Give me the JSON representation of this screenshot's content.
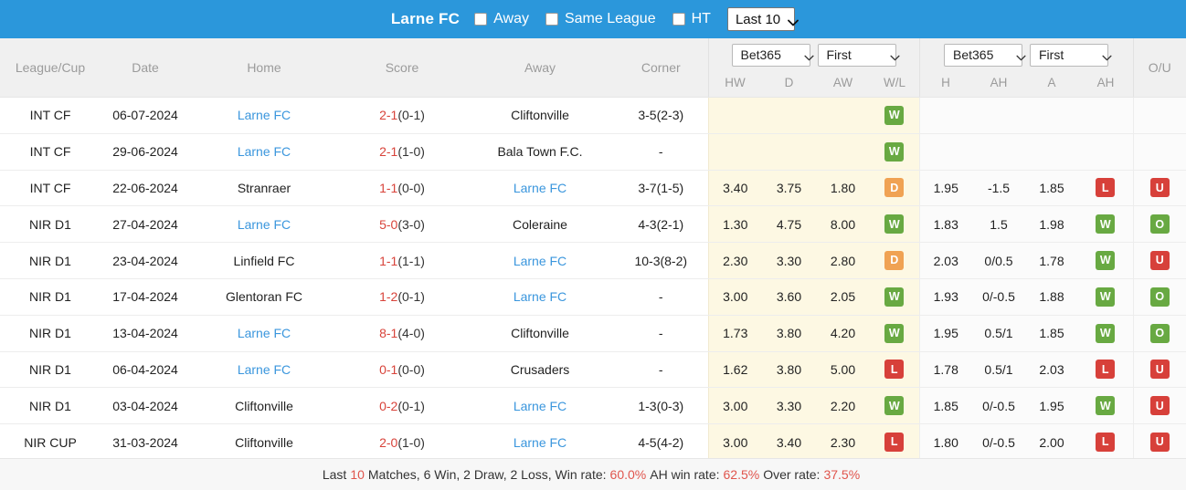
{
  "topbar": {
    "team_name": "Larne FC",
    "filters": [
      {
        "label": "Away",
        "checked": false
      },
      {
        "label": "Same League",
        "checked": false
      },
      {
        "label": "HT",
        "checked": false
      }
    ],
    "range_select": {
      "value": "Last 10",
      "icon": "chevron-down-icon"
    },
    "background_color": "#2b97db"
  },
  "table": {
    "columns": [
      {
        "key": "league",
        "label": "League/Cup"
      },
      {
        "key": "date",
        "label": "Date"
      },
      {
        "key": "home",
        "label": "Home"
      },
      {
        "key": "score",
        "label": "Score"
      },
      {
        "key": "away",
        "label": "Away"
      },
      {
        "key": "corner",
        "label": "Corner"
      }
    ],
    "odds_group_1x2": {
      "bookmaker_select": {
        "value": "Bet365",
        "icon": "chevron-down-icon"
      },
      "phase_select": {
        "value": "First",
        "icon": "chevron-down-icon"
      },
      "sub_columns": [
        "HW",
        "D",
        "AW",
        "W/L"
      ]
    },
    "odds_group_ah": {
      "bookmaker_select": {
        "value": "Bet365",
        "icon": "chevron-down-icon"
      },
      "phase_select": {
        "value": "First",
        "icon": "chevron-down-icon"
      },
      "sub_columns": [
        "H",
        "AH",
        "A",
        "AH"
      ]
    },
    "ou_column": {
      "label": "O/U"
    },
    "rows": [
      {
        "league": "INT CF",
        "date": "06-07-2024",
        "home": "Larne FC",
        "home_is_team": true,
        "score": "2-1",
        "score_ht": "(0-1)",
        "away": "Cliftonville",
        "away_is_team": false,
        "corner": "3-5(2-3)",
        "hw": "",
        "d": "",
        "aw": "",
        "wl": "W",
        "h": "",
        "ah_line": "",
        "a": "",
        "ah_result": "",
        "ou": ""
      },
      {
        "league": "INT CF",
        "date": "29-06-2024",
        "home": "Larne FC",
        "home_is_team": true,
        "score": "2-1",
        "score_ht": "(1-0)",
        "away": "Bala Town F.C.",
        "away_is_team": false,
        "corner": "-",
        "hw": "",
        "d": "",
        "aw": "",
        "wl": "W",
        "h": "",
        "ah_line": "",
        "a": "",
        "ah_result": "",
        "ou": ""
      },
      {
        "league": "INT CF",
        "date": "22-06-2024",
        "home": "Stranraer",
        "home_is_team": false,
        "score": "1-1",
        "score_ht": "(0-0)",
        "away": "Larne FC",
        "away_is_team": true,
        "corner": "3-7(1-5)",
        "hw": "3.40",
        "d": "3.75",
        "aw": "1.80",
        "wl": "D",
        "h": "1.95",
        "ah_line": "-1.5",
        "a": "1.85",
        "ah_result": "L",
        "ou": "U"
      },
      {
        "league": "NIR D1",
        "date": "27-04-2024",
        "home": "Larne FC",
        "home_is_team": true,
        "score": "5-0",
        "score_ht": "(3-0)",
        "away": "Coleraine",
        "away_is_team": false,
        "corner": "4-3(2-1)",
        "hw": "1.30",
        "d": "4.75",
        "aw": "8.00",
        "wl": "W",
        "h": "1.83",
        "ah_line": "1.5",
        "a": "1.98",
        "ah_result": "W",
        "ou": "O"
      },
      {
        "league": "NIR D1",
        "date": "23-04-2024",
        "home": "Linfield FC",
        "home_is_team": false,
        "score": "1-1",
        "score_ht": "(1-1)",
        "away": "Larne FC",
        "away_is_team": true,
        "corner": "10-3(8-2)",
        "hw": "2.30",
        "d": "3.30",
        "aw": "2.80",
        "wl": "D",
        "h": "2.03",
        "ah_line": "0/0.5",
        "a": "1.78",
        "ah_result": "W",
        "ou": "U"
      },
      {
        "league": "NIR D1",
        "date": "17-04-2024",
        "home": "Glentoran FC",
        "home_is_team": false,
        "score": "1-2",
        "score_ht": "(0-1)",
        "away": "Larne FC",
        "away_is_team": true,
        "corner": "-",
        "hw": "3.00",
        "d": "3.60",
        "aw": "2.05",
        "wl": "W",
        "h": "1.93",
        "ah_line": "0/-0.5",
        "a": "1.88",
        "ah_result": "W",
        "ou": "O"
      },
      {
        "league": "NIR D1",
        "date": "13-04-2024",
        "home": "Larne FC",
        "home_is_team": true,
        "score": "8-1",
        "score_ht": "(4-0)",
        "away": "Cliftonville",
        "away_is_team": false,
        "corner": "-",
        "hw": "1.73",
        "d": "3.80",
        "aw": "4.20",
        "wl": "W",
        "h": "1.95",
        "ah_line": "0.5/1",
        "a": "1.85",
        "ah_result": "W",
        "ou": "O"
      },
      {
        "league": "NIR D1",
        "date": "06-04-2024",
        "home": "Larne FC",
        "home_is_team": true,
        "score": "0-1",
        "score_ht": "(0-0)",
        "away": "Crusaders",
        "away_is_team": false,
        "corner": "-",
        "hw": "1.62",
        "d": "3.80",
        "aw": "5.00",
        "wl": "L",
        "h": "1.78",
        "ah_line": "0.5/1",
        "a": "2.03",
        "ah_result": "L",
        "ou": "U"
      },
      {
        "league": "NIR D1",
        "date": "03-04-2024",
        "home": "Cliftonville",
        "home_is_team": false,
        "score": "0-2",
        "score_ht": "(0-1)",
        "away": "Larne FC",
        "away_is_team": true,
        "corner": "1-3(0-3)",
        "hw": "3.00",
        "d": "3.30",
        "aw": "2.20",
        "wl": "W",
        "h": "1.85",
        "ah_line": "0/-0.5",
        "a": "1.95",
        "ah_result": "W",
        "ou": "U"
      },
      {
        "league": "NIR CUP",
        "date": "31-03-2024",
        "home": "Cliftonville",
        "home_is_team": false,
        "score": "2-0",
        "score_ht": "(1-0)",
        "away": "Larne FC",
        "away_is_team": true,
        "corner": "4-5(4-2)",
        "hw": "3.00",
        "d": "3.40",
        "aw": "2.30",
        "wl": "L",
        "h": "1.80",
        "ah_line": "0/-0.5",
        "a": "2.00",
        "ah_result": "L",
        "ou": "U"
      }
    ]
  },
  "footer": {
    "prefix": "Last",
    "match_count": "10",
    "summary": "Matches, 6 Win, 2 Draw, 2 Loss, Win rate:",
    "win_rate": "60.0%",
    "ah_label": "AH win rate:",
    "ah_rate": "62.5%",
    "over_label": "Over rate:",
    "over_rate": "37.5%"
  },
  "colors": {
    "accent": "#2b97db",
    "win": "#68a942",
    "loss": "#d7403a",
    "draw": "#f0a253",
    "link": "#3a96dd",
    "score": "#d8433a",
    "highlight_row_bg": "#fdf8e3"
  }
}
